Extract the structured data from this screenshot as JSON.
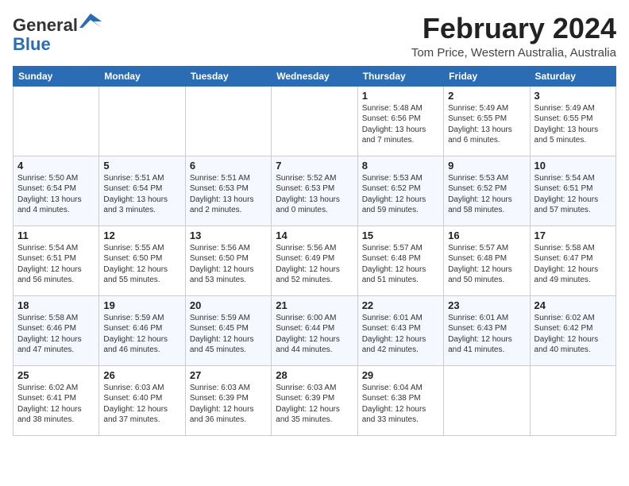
{
  "logo": {
    "general": "General",
    "blue": "Blue"
  },
  "title": "February 2024",
  "location": "Tom Price, Western Australia, Australia",
  "days_of_week": [
    "Sunday",
    "Monday",
    "Tuesday",
    "Wednesday",
    "Thursday",
    "Friday",
    "Saturday"
  ],
  "weeks": [
    [
      {
        "day": "",
        "info": ""
      },
      {
        "day": "",
        "info": ""
      },
      {
        "day": "",
        "info": ""
      },
      {
        "day": "",
        "info": ""
      },
      {
        "day": "1",
        "info": "Sunrise: 5:48 AM\nSunset: 6:56 PM\nDaylight: 13 hours\nand 7 minutes."
      },
      {
        "day": "2",
        "info": "Sunrise: 5:49 AM\nSunset: 6:55 PM\nDaylight: 13 hours\nand 6 minutes."
      },
      {
        "day": "3",
        "info": "Sunrise: 5:49 AM\nSunset: 6:55 PM\nDaylight: 13 hours\nand 5 minutes."
      }
    ],
    [
      {
        "day": "4",
        "info": "Sunrise: 5:50 AM\nSunset: 6:54 PM\nDaylight: 13 hours\nand 4 minutes."
      },
      {
        "day": "5",
        "info": "Sunrise: 5:51 AM\nSunset: 6:54 PM\nDaylight: 13 hours\nand 3 minutes."
      },
      {
        "day": "6",
        "info": "Sunrise: 5:51 AM\nSunset: 6:53 PM\nDaylight: 13 hours\nand 2 minutes."
      },
      {
        "day": "7",
        "info": "Sunrise: 5:52 AM\nSunset: 6:53 PM\nDaylight: 13 hours\nand 0 minutes."
      },
      {
        "day": "8",
        "info": "Sunrise: 5:53 AM\nSunset: 6:52 PM\nDaylight: 12 hours\nand 59 minutes."
      },
      {
        "day": "9",
        "info": "Sunrise: 5:53 AM\nSunset: 6:52 PM\nDaylight: 12 hours\nand 58 minutes."
      },
      {
        "day": "10",
        "info": "Sunrise: 5:54 AM\nSunset: 6:51 PM\nDaylight: 12 hours\nand 57 minutes."
      }
    ],
    [
      {
        "day": "11",
        "info": "Sunrise: 5:54 AM\nSunset: 6:51 PM\nDaylight: 12 hours\nand 56 minutes."
      },
      {
        "day": "12",
        "info": "Sunrise: 5:55 AM\nSunset: 6:50 PM\nDaylight: 12 hours\nand 55 minutes."
      },
      {
        "day": "13",
        "info": "Sunrise: 5:56 AM\nSunset: 6:50 PM\nDaylight: 12 hours\nand 53 minutes."
      },
      {
        "day": "14",
        "info": "Sunrise: 5:56 AM\nSunset: 6:49 PM\nDaylight: 12 hours\nand 52 minutes."
      },
      {
        "day": "15",
        "info": "Sunrise: 5:57 AM\nSunset: 6:48 PM\nDaylight: 12 hours\nand 51 minutes."
      },
      {
        "day": "16",
        "info": "Sunrise: 5:57 AM\nSunset: 6:48 PM\nDaylight: 12 hours\nand 50 minutes."
      },
      {
        "day": "17",
        "info": "Sunrise: 5:58 AM\nSunset: 6:47 PM\nDaylight: 12 hours\nand 49 minutes."
      }
    ],
    [
      {
        "day": "18",
        "info": "Sunrise: 5:58 AM\nSunset: 6:46 PM\nDaylight: 12 hours\nand 47 minutes."
      },
      {
        "day": "19",
        "info": "Sunrise: 5:59 AM\nSunset: 6:46 PM\nDaylight: 12 hours\nand 46 minutes."
      },
      {
        "day": "20",
        "info": "Sunrise: 5:59 AM\nSunset: 6:45 PM\nDaylight: 12 hours\nand 45 minutes."
      },
      {
        "day": "21",
        "info": "Sunrise: 6:00 AM\nSunset: 6:44 PM\nDaylight: 12 hours\nand 44 minutes."
      },
      {
        "day": "22",
        "info": "Sunrise: 6:01 AM\nSunset: 6:43 PM\nDaylight: 12 hours\nand 42 minutes."
      },
      {
        "day": "23",
        "info": "Sunrise: 6:01 AM\nSunset: 6:43 PM\nDaylight: 12 hours\nand 41 minutes."
      },
      {
        "day": "24",
        "info": "Sunrise: 6:02 AM\nSunset: 6:42 PM\nDaylight: 12 hours\nand 40 minutes."
      }
    ],
    [
      {
        "day": "25",
        "info": "Sunrise: 6:02 AM\nSunset: 6:41 PM\nDaylight: 12 hours\nand 38 minutes."
      },
      {
        "day": "26",
        "info": "Sunrise: 6:03 AM\nSunset: 6:40 PM\nDaylight: 12 hours\nand 37 minutes."
      },
      {
        "day": "27",
        "info": "Sunrise: 6:03 AM\nSunset: 6:39 PM\nDaylight: 12 hours\nand 36 minutes."
      },
      {
        "day": "28",
        "info": "Sunrise: 6:03 AM\nSunset: 6:39 PM\nDaylight: 12 hours\nand 35 minutes."
      },
      {
        "day": "29",
        "info": "Sunrise: 6:04 AM\nSunset: 6:38 PM\nDaylight: 12 hours\nand 33 minutes."
      },
      {
        "day": "",
        "info": ""
      },
      {
        "day": "",
        "info": ""
      }
    ]
  ]
}
